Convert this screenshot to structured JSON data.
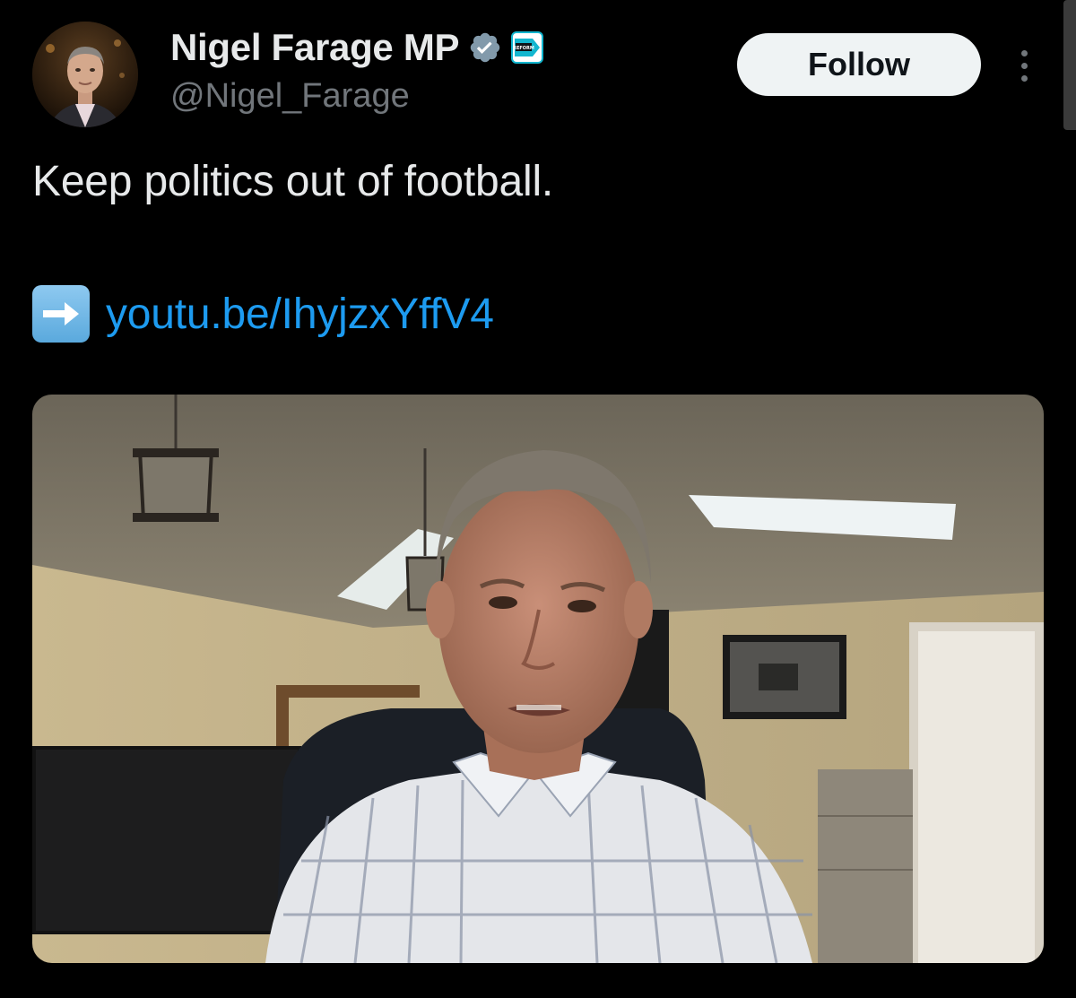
{
  "author": {
    "display_name": "Nigel Farage MP",
    "handle": "@Nigel_Farage",
    "verified_icon": "verified-badge-icon",
    "affiliation_label": "REFORM UK",
    "avatar": "profile-photo"
  },
  "actions": {
    "follow_label": "Follow",
    "more_icon": "more-dots-icon"
  },
  "tweet": {
    "text": "Keep politics out of football.",
    "link_emoji": "right-arrow-emoji",
    "link_text": "youtu.be/IhyjzxYffV4"
  },
  "media": {
    "type": "video-thumbnail",
    "description_icon": "video-still"
  },
  "colors": {
    "background": "#000000",
    "primary_text": "#e7e9ea",
    "secondary_text": "#71767b",
    "link": "#1d9bf0",
    "verified": "#829aab",
    "follow_bg": "#eff3f4",
    "reform_accent": "#12b6cf"
  }
}
